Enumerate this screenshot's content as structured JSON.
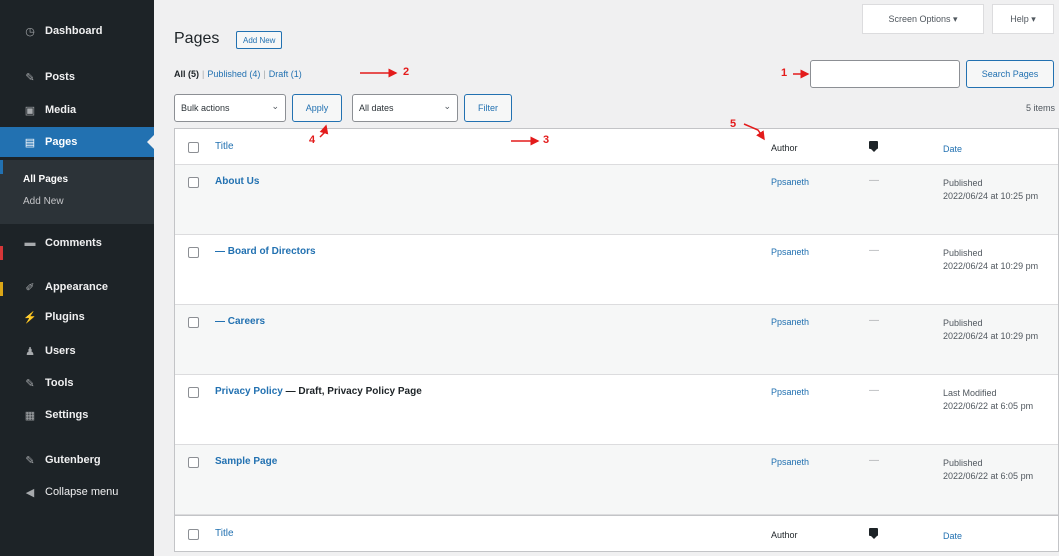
{
  "sidebar": {
    "items": [
      {
        "label": "Dashboard",
        "icon": "dashboard-icon",
        "glyph": "◷"
      },
      {
        "label": "Posts",
        "icon": "pushpin-icon",
        "glyph": "✎"
      },
      {
        "label": "Media",
        "icon": "media-icon",
        "glyph": "▣"
      },
      {
        "label": "Pages",
        "icon": "page-icon",
        "glyph": "▤"
      },
      {
        "label": "Comments",
        "icon": "comment-icon",
        "glyph": "▬"
      },
      {
        "label": "Appearance",
        "icon": "paintbrush-icon",
        "glyph": "✐"
      },
      {
        "label": "Plugins",
        "icon": "plugin-icon",
        "glyph": "⚡"
      },
      {
        "label": "Users",
        "icon": "users-icon",
        "glyph": "♟"
      },
      {
        "label": "Tools",
        "icon": "wrench-icon",
        "glyph": "✎"
      },
      {
        "label": "Settings",
        "icon": "settings-icon",
        "glyph": "▦"
      },
      {
        "label": "Gutenberg",
        "icon": "gutenberg-icon",
        "glyph": "✎"
      },
      {
        "label": "Collapse menu",
        "icon": "collapse-icon",
        "glyph": "◀"
      }
    ],
    "submenu": [
      "All Pages",
      "Add New"
    ]
  },
  "header": {
    "screen_options": "Screen Options ▾",
    "help": "Help ▾",
    "title": "Pages",
    "add_new": "Add New"
  },
  "filters": {
    "all": "All (5)",
    "published": "Published (4)",
    "draft": "Draft (1)",
    "separator": "|"
  },
  "search": {
    "value": "",
    "button": "Search Pages"
  },
  "bulk": {
    "select": "Bulk actions",
    "apply": "Apply",
    "dates": "All dates",
    "filter": "Filter",
    "items_count": "5 items"
  },
  "table": {
    "columns": {
      "title": "Title",
      "author": "Author",
      "date": "Date"
    },
    "rows": [
      {
        "title": "About Us",
        "state": "",
        "author": "Ppsaneth",
        "comments": "—",
        "date_status": "Published",
        "date_value": "2022/06/24 at 10:25 pm"
      },
      {
        "title": "— Board of Directors",
        "state": "",
        "author": "Ppsaneth",
        "comments": "—",
        "date_status": "Published",
        "date_value": "2022/06/24 at 10:29 pm"
      },
      {
        "title": "— Careers",
        "state": "",
        "author": "Ppsaneth",
        "comments": "—",
        "date_status": "Published",
        "date_value": "2022/06/24 at 10:29 pm"
      },
      {
        "title": "Privacy Policy",
        "state": " — Draft, Privacy Policy Page",
        "author": "Ppsaneth",
        "comments": "—",
        "date_status": "Last Modified",
        "date_value": "2022/06/22 at 6:05 pm"
      },
      {
        "title": "Sample Page",
        "state": "",
        "author": "Ppsaneth",
        "comments": "—",
        "date_status": "Published",
        "date_value": "2022/06/22 at 6:05 pm"
      }
    ]
  },
  "annotations": [
    "1",
    "2",
    "3",
    "4",
    "5"
  ]
}
